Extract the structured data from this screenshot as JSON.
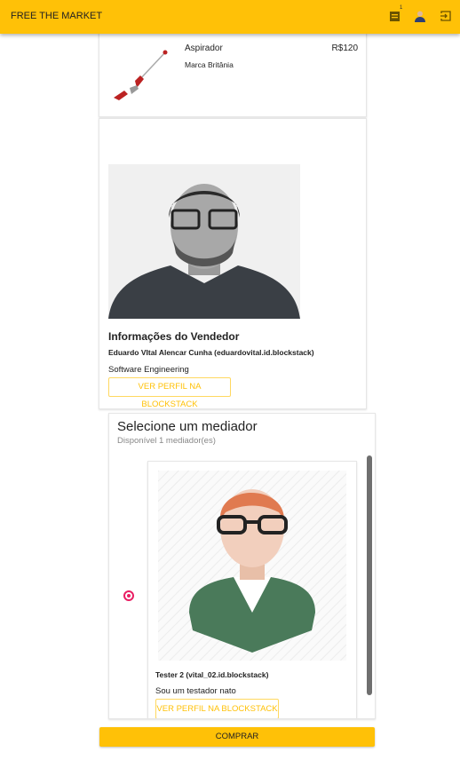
{
  "header": {
    "title": "FREE THE MARKET",
    "cart_badge": "1",
    "icons": [
      "cart-list-icon",
      "user-avatar-icon",
      "logout-icon"
    ]
  },
  "product": {
    "name": "Aspirador",
    "price": "R$120",
    "brand": "Marca Britânia"
  },
  "seller": {
    "heading": "Informações do Vendedor",
    "name": "Eduardo VItal Alencar Cunha (eduardovital.id.blockstack)",
    "description": "Software Engineering",
    "profile_button": "VER PERFIL NA BLOCKSTACK"
  },
  "mediator": {
    "heading": "Selecione um mediador",
    "subtitle": "Disponível 1 mediador(es)",
    "items": [
      {
        "name": "Tester 2 (vital_02.id.blockstack)",
        "description": "Sou um testador nato",
        "profile_button": "VER PERFIL NA BLOCKSTACK",
        "selected": true
      }
    ]
  },
  "buy_button": "COMPRAR",
  "colors": {
    "primary": "#FFC107",
    "radio": "#E91E63"
  }
}
